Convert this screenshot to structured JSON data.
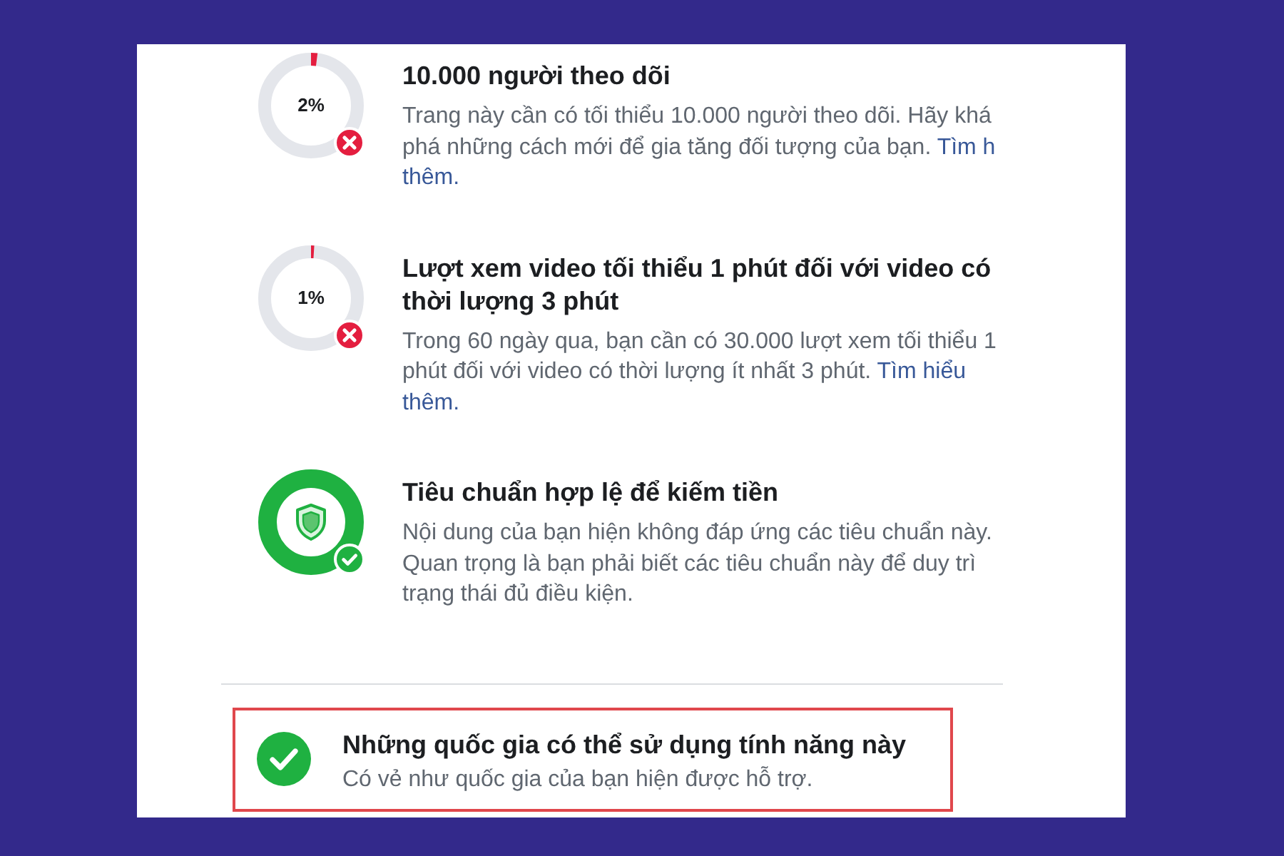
{
  "requirements": [
    {
      "kind": "progress",
      "passed": false,
      "progress": {
        "label": "2%",
        "level": 0.02
      },
      "title": "10.000 người theo dõi",
      "description": [
        [
          {
            "kind": "text",
            "text": "Trang này cần có tối thiểu 10.000 người theo dõi. Hãy khá"
          }
        ],
        [
          {
            "kind": "text",
            "text": "phá những cách mới để gia tăng đối tượng của bạn."
          },
          {
            "kind": "link",
            "text": "Tìm h"
          }
        ],
        [
          {
            "kind": "link",
            "text": "thêm."
          }
        ]
      ]
    },
    {
      "kind": "progress",
      "passed": false,
      "progress": {
        "label": "1%",
        "level": 0.01
      },
      "title": "Lượt xem video tối thiểu 1 phút đối với video có thời lượng 3 phút",
      "description": [
        [
          {
            "kind": "text",
            "text": "Trong 60 ngày qua, bạn cần có 30.000 lượt xem tối thiểu 1"
          }
        ],
        [
          {
            "kind": "text",
            "text": "phút đối với video có thời lượng ít nhất 3 phút."
          },
          {
            "kind": "link",
            "text": "Tìm hiểu"
          }
        ],
        [
          {
            "kind": "link",
            "text": "thêm."
          }
        ]
      ]
    },
    {
      "kind": "shield",
      "passed": true,
      "title": "Tiêu chuẩn hợp lệ để kiếm tiền",
      "description": [
        [
          {
            "kind": "text",
            "text": "Nội dung của bạn hiện không đáp ứng các tiêu chuẩn này."
          }
        ],
        [
          {
            "kind": "text",
            "text": "Quan trọng là bạn phải biết các tiêu chuẩn này để duy trì"
          }
        ],
        [
          {
            "kind": "text",
            "text": "trạng thái đủ điều kiện."
          }
        ]
      ]
    }
  ],
  "summary": {
    "passed": true,
    "highlighted": true,
    "title": "Những quốc gia có thể sử dụng tính năng này",
    "description": "Có vẻ như quốc gia của bạn hiện được hỗ trợ."
  }
}
